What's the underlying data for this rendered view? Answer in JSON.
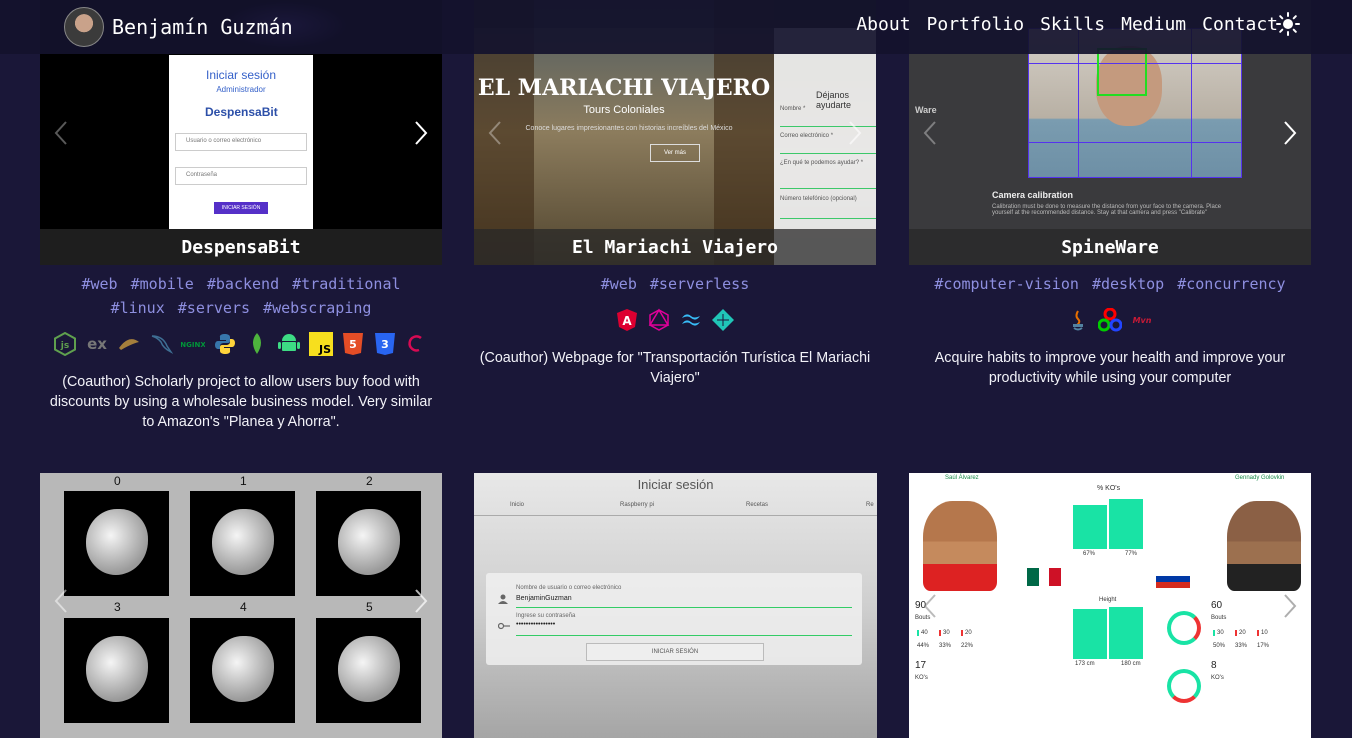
{
  "nav": {
    "brand_name": "Benjamín Guzmán",
    "links": [
      "About",
      "Portfolio",
      "Skills",
      "Medium",
      "Contact"
    ]
  },
  "cards": [
    {
      "title": "DespensaBit",
      "tags": [
        "#web",
        "#mobile",
        "#backend",
        "#traditional",
        "#linux",
        "#servers",
        "#webscraping"
      ],
      "tech_icons": [
        "nodejs-icon",
        "express-icon",
        "mongoose-icon",
        "mysql-icon",
        "nginx-icon",
        "python-icon",
        "mongodb-icon",
        "android-icon",
        "javascript-icon",
        "html5-icon",
        "css3-icon",
        "debian-icon"
      ],
      "description": "(Coauthor) Scholarly project to allow users buy food with discounts by using a wholesale business model. Very similar to Amazon's \"Planea y Ahorra\".",
      "screenshot": {
        "title": "Iniciar sesión",
        "subtitle": "Administrador",
        "logo": "DespensaBit",
        "email_placeholder": "Usuario o correo electrónico",
        "password_placeholder": "Contraseña",
        "button": "INICIAR SESIÓN"
      }
    },
    {
      "title": "El Mariachi Viajero",
      "tags": [
        "#web",
        "#serverless"
      ],
      "tech_icons": [
        "angular-icon",
        "graphql-icon",
        "tailwind-icon",
        "netlify-icon"
      ],
      "description": "(Coauthor) Webpage for \"Transportación Turística El Mariachi Viajero\"",
      "screenshot": {
        "title": "EL MARIACHI VIAJERO",
        "subtitle": "Tours Coloniales",
        "tagline": "Conoce lugares impresionantes con historias increíbles del México",
        "button": "Ver más",
        "form_title": "Déjanos ayudarte",
        "form_labels": [
          "Nombre *",
          "Correo electrónico *",
          "¿En qué te podemos ayudar? *",
          "Número telefónico (opcional)"
        ]
      }
    },
    {
      "title": "SpineWare",
      "tags": [
        "#computer-vision",
        "#desktop",
        "#concurrency"
      ],
      "tech_icons": [
        "java-icon",
        "opencv-icon",
        "maven-icon"
      ],
      "description": "Acquire habits to improve your health and improve your productivity while using your computer",
      "screenshot": {
        "header": "Ware",
        "title": "Camera calibration",
        "text": "Calibration must be done to measure the distance from your face to the camera. Place yourself at the recommended distance. Stay at that camera and press \"Calibrate\""
      }
    },
    {
      "screenshot": {
        "labels": [
          "0",
          "1",
          "2",
          "3",
          "4",
          "5"
        ]
      }
    },
    {
      "screenshot": {
        "title": "Iniciar sesión",
        "tabs": [
          "Inicio",
          "Raspberry pi",
          "Recetas",
          "Re"
        ],
        "user_label": "Nombre de usuario o correo electrónico",
        "user_value": "BenjaminGuzman",
        "password_label": "Ingrese su contraseña",
        "password_value": "••••••••••••••••",
        "button": "INICIAR SESIÓN"
      }
    },
    {
      "screenshot": {
        "left_name": "Saúl Álvarez",
        "right_name": "Gennady Golovkin",
        "ko_title": "% KO's",
        "ko_left": "67%",
        "ko_right": "77%",
        "height_title": "Height",
        "height_left": "173 cm",
        "height_right": "180 cm",
        "left_bouts": "90",
        "right_bouts": "60",
        "bouts_label": "Bouts",
        "left_record": [
          "40",
          "30",
          "20"
        ],
        "left_record_pct": [
          "44%",
          "33%",
          "22%"
        ],
        "right_record": [
          "30",
          "20",
          "10"
        ],
        "right_record_pct": [
          "50%",
          "33%",
          "17%"
        ],
        "left_kos": "17",
        "right_kos": "8",
        "kos_label": "KO's"
      }
    }
  ],
  "colors": {
    "background": "#1a1738",
    "tag": "#8e8fe0",
    "accent_green": "#19e3a5"
  }
}
